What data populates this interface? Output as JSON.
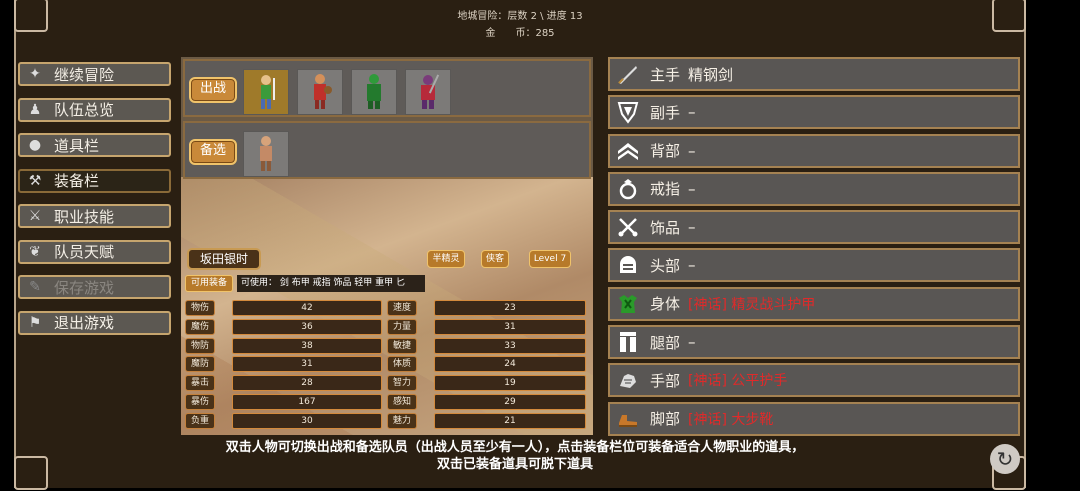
{
  "header": {
    "line1": "地城冒险：层数 2 \\ 进度 13",
    "gold_label": "金　　币",
    "gold_value": "285"
  },
  "menu": [
    {
      "label": "继续冒险",
      "icon": "adventure-icon"
    },
    {
      "label": "队伍总览",
      "icon": "party-icon"
    },
    {
      "label": "道具栏",
      "icon": "bag-icon"
    },
    {
      "label": "装备栏",
      "icon": "equipment-icon"
    },
    {
      "label": "职业技能",
      "icon": "skill-icon"
    },
    {
      "label": "队员天赋",
      "icon": "talent-icon"
    },
    {
      "label": "保存游戏",
      "icon": "scroll-icon"
    },
    {
      "label": "退出游戏",
      "icon": "flag-icon"
    }
  ],
  "party": {
    "battle_label": "出战",
    "reserve_label": "备选"
  },
  "character": {
    "name": "坂田银时",
    "race": "半精灵",
    "class": "侠客",
    "level": "Level 7",
    "available_button": "可用装备",
    "usable": "可使用：  剑  布甲  戒指  饰品  轻甲  重甲  匕"
  },
  "stats": {
    "left": [
      {
        "label": "物伤",
        "value": "42"
      },
      {
        "label": "魔伤",
        "value": "36"
      },
      {
        "label": "物防",
        "value": "38"
      },
      {
        "label": "魔防",
        "value": "31"
      },
      {
        "label": "暴击",
        "value": "28"
      },
      {
        "label": "暴伤",
        "value": "167"
      },
      {
        "label": "负重",
        "value": "30"
      }
    ],
    "right": [
      {
        "label": "速度",
        "value": "23"
      },
      {
        "label": "力量",
        "value": "31"
      },
      {
        "label": "敏捷",
        "value": "33"
      },
      {
        "label": "体质",
        "value": "24"
      },
      {
        "label": "智力",
        "value": "19"
      },
      {
        "label": "感知",
        "value": "29"
      },
      {
        "label": "魅力",
        "value": "21"
      }
    ]
  },
  "equipment": [
    {
      "slot": "主手",
      "item": "精钢剑",
      "icon": "sword-icon",
      "rare": false
    },
    {
      "slot": "副手",
      "item": "–",
      "icon": "shield-icon",
      "rare": false
    },
    {
      "slot": "背部",
      "item": "–",
      "icon": "back-chevron-icon",
      "rare": false
    },
    {
      "slot": "戒指",
      "item": "–",
      "icon": "ring-icon",
      "rare": false
    },
    {
      "slot": "饰品",
      "item": "–",
      "icon": "accessory-icon",
      "rare": false
    },
    {
      "slot": "头部",
      "item": "–",
      "icon": "helmet-icon",
      "rare": false
    },
    {
      "slot": "身体",
      "item": "[神话] 精灵战斗护甲",
      "icon": "armor-icon",
      "rare": true
    },
    {
      "slot": "腿部",
      "item": "–",
      "icon": "legs-icon",
      "rare": false
    },
    {
      "slot": "手部",
      "item": "[神话] 公平护手",
      "icon": "gauntlet-icon",
      "rare": true
    },
    {
      "slot": "脚部",
      "item": "[神话] 大步靴",
      "icon": "boots-icon",
      "rare": true
    }
  ],
  "footer": {
    "line1": "双击人物可切换出战和备选队员（出战人员至少有一人），点击装备栏位可装备适合人物职业的道具，",
    "line2": "双击已装备道具可脱下道具"
  }
}
